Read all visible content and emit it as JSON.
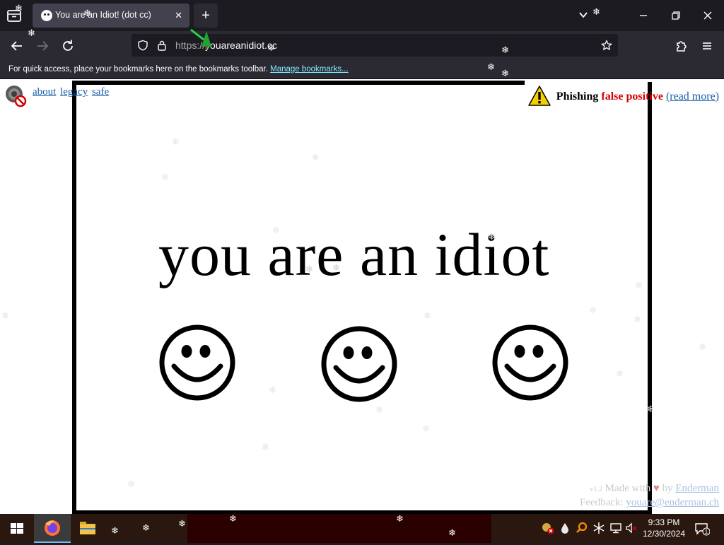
{
  "browser": {
    "tab_title": "You are an Idiot! (dot cc)",
    "url_prefix": "https://",
    "url_host": "youareanidiot.cc",
    "bookmarks_message": "For quick access, place your bookmarks here on the bookmarks toolbar.",
    "bookmarks_link": "Manage bookmarks..."
  },
  "page": {
    "links": [
      "about",
      "legacy",
      "safe"
    ],
    "phishing_label": "Phishing",
    "false_positive_label": "false positive",
    "read_more": "(read more)",
    "headline": "you are an idiot",
    "version": "v1.2",
    "made_with": "Made with",
    "by": "by",
    "author": "Enderman",
    "feedback_label": "Feedback:",
    "feedback_email": "youare@enderman.ch"
  },
  "taskbar": {
    "time": "9:33 PM",
    "date": "12/30/2024",
    "notification_count": "1"
  },
  "colors": {
    "chrome_dark": "#1c1b22",
    "chrome_mid": "#2b2a33",
    "tab_active": "#42414d",
    "link": "#1a5fa8",
    "warning_red": "#d40000"
  }
}
